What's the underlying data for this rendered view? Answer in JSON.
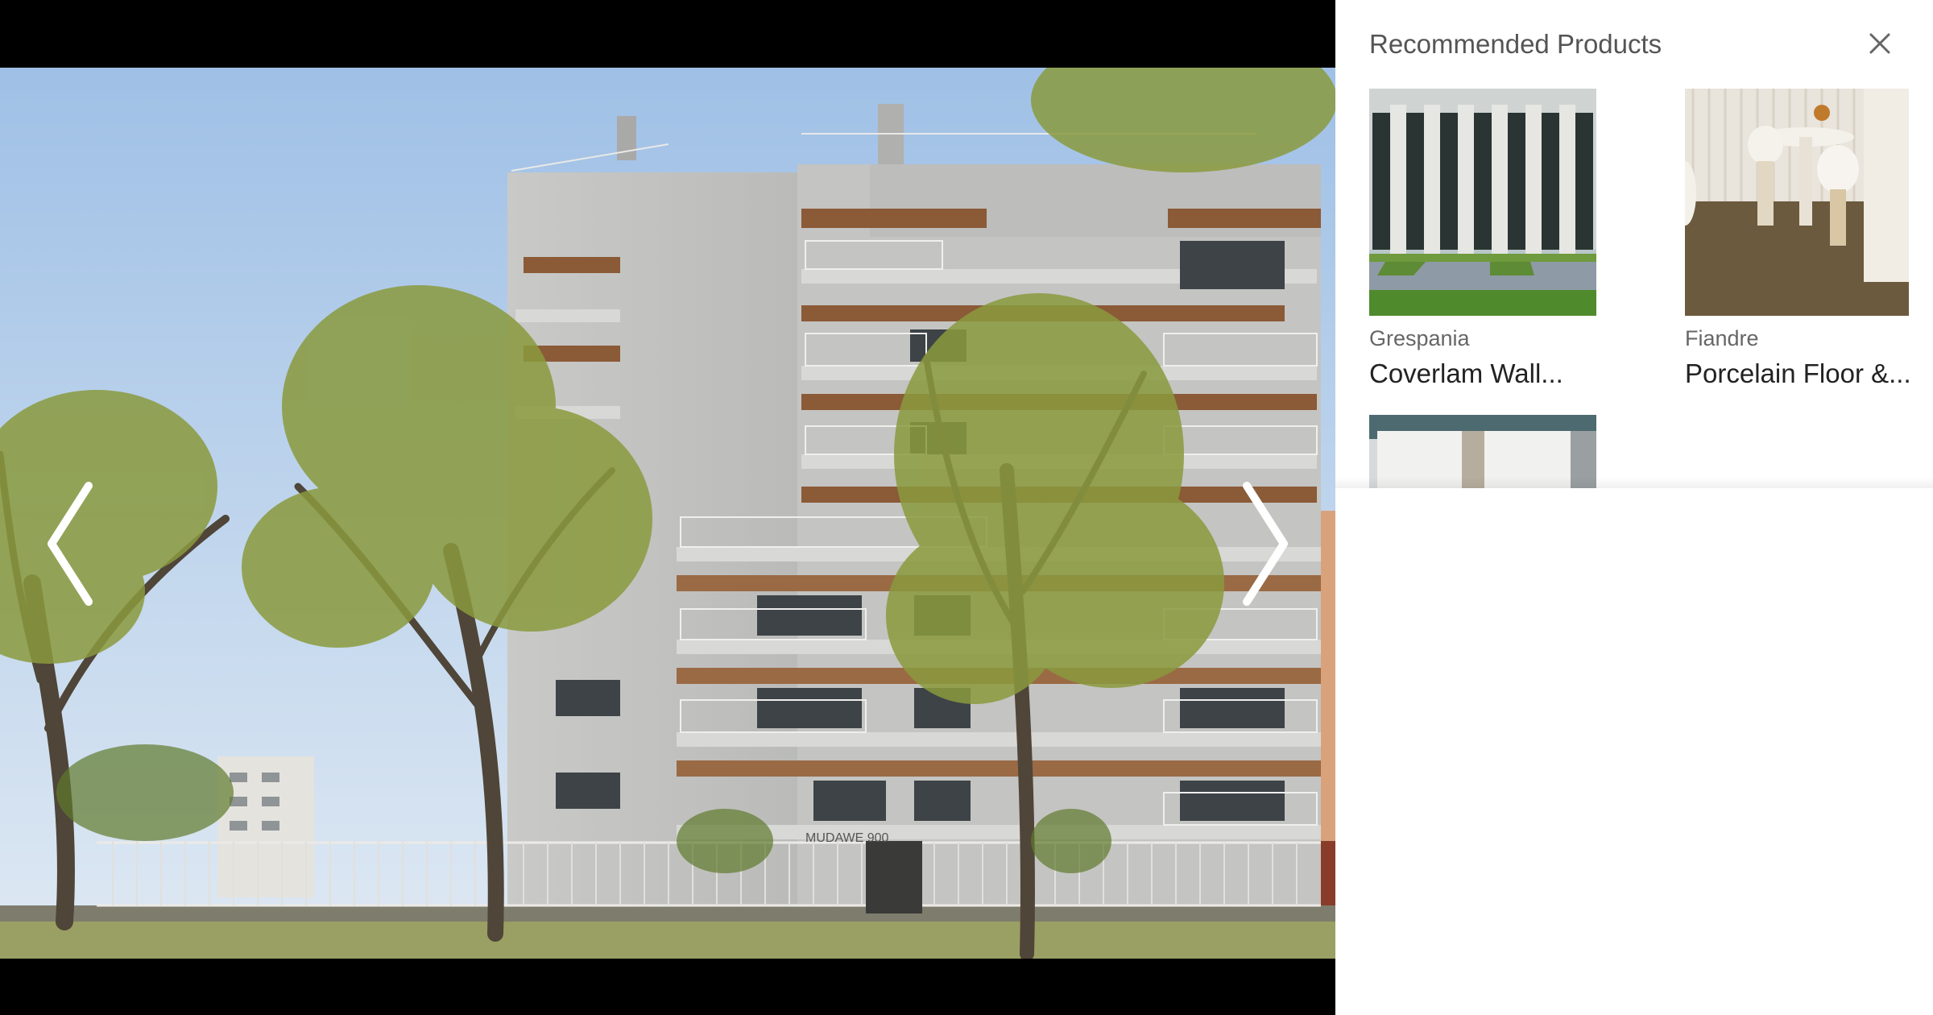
{
  "viewer": {
    "image_alt": "Exterior of a multi-storey concrete apartment building with balconies behind trees and a white fence",
    "building_sign": "MUDAWE 900",
    "prev_icon": "chevron-left-icon",
    "next_icon": "chevron-right-icon"
  },
  "panel": {
    "title": "Recommended Products",
    "close_icon": "close-icon",
    "products": [
      {
        "brand": "Grespania",
        "name": "Coverlam Wall..."
      },
      {
        "brand": "Fiandre",
        "name": "Porcelain Floor &..."
      },
      {
        "brand": "",
        "name": ""
      }
    ]
  },
  "colors": {
    "panel_background": "#ffffff",
    "viewer_background": "#000000",
    "title_text": "#555555",
    "brand_text": "#666666",
    "product_text": "#222222"
  }
}
